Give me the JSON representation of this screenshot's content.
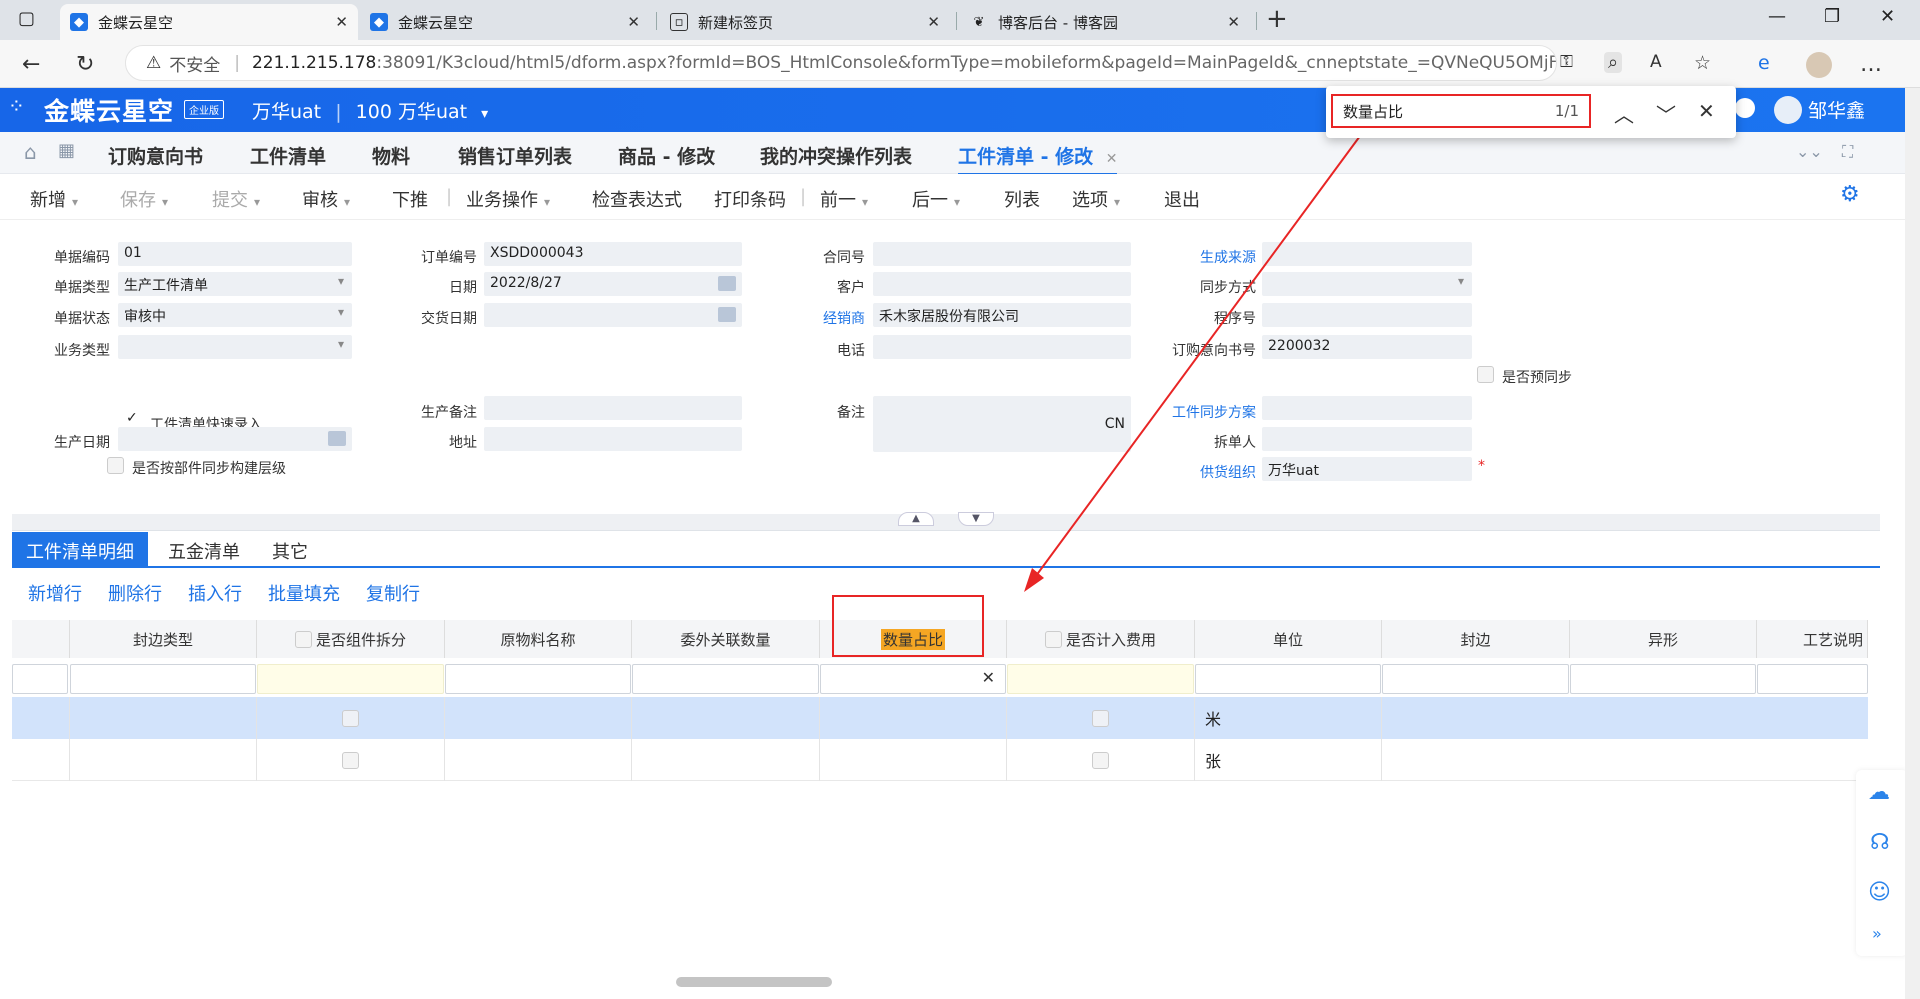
{
  "browser": {
    "tabs": [
      {
        "title": "金蝶云星空",
        "icon": "kingdee-icon"
      },
      {
        "title": "金蝶云星空",
        "icon": "kingdee-icon"
      },
      {
        "title": "新建标签页",
        "icon": "new-tab-icon"
      },
      {
        "title": "博客后台 - 博客园",
        "icon": "cnblogs-icon"
      }
    ],
    "security_label": "不安全",
    "url_host": "221.1.215.178",
    "url_rest": ":38091/K3cloud/html5/dform.aspx?formId=BOS_HtmlConsole&formType=mobileform&pageId=MainPageId&_cnneptstate_=QVNeQU5OMjFBTk5WQU..."
  },
  "find": {
    "query": "数量占比",
    "count": "1/1"
  },
  "app": {
    "brand": "金蝶云星空",
    "edition": "企业版",
    "org": "万华uat",
    "sep": "|",
    "org_code": "100 万华uat",
    "user": "邹华鑫",
    "tabs": [
      "订购意向书",
      "工件清单",
      "物料",
      "销售订单列表",
      "商品 - 修改",
      "我的冲突操作列表",
      "工件清单 - 修改"
    ]
  },
  "toolbar": [
    "新增",
    "保存",
    "提交",
    "审核",
    "下推",
    "业务操作",
    "检查表达式",
    "打印条码",
    "前一",
    "后一",
    "列表",
    "选项",
    "退出"
  ],
  "form": {
    "doc_no_label": "单据编码",
    "doc_no": "01",
    "doc_type_label": "单据类型",
    "doc_type": "生产工件清单",
    "doc_status_label": "单据状态",
    "doc_status": "审核中",
    "biz_type_label": "业务类型",
    "quick_entry_label": "工件清单快速录入",
    "prod_date_label": "生产日期",
    "sync_layer_label": "是否按部件同步构建层级",
    "order_no_label": "订单编号",
    "order_no": "XSDD000043",
    "date_label": "日期",
    "date": "2022/8/27",
    "delivery_label": "交货日期",
    "prod_note_label": "生产备注",
    "address_label": "地址",
    "contract_label": "合同号",
    "customer_label": "客户",
    "dealer_label": "经销商",
    "dealer": "禾木家居股份有限公司",
    "phone_label": "电话",
    "remark_label": "备注",
    "remark": "CN",
    "source_label": "生成来源",
    "sync_mode_label": "同步方式",
    "proc_no_label": "程序号",
    "intent_no_label": "订购意向书号",
    "intent_no": "2200032",
    "pre_sync_label": "是否预同步",
    "sync_plan_label": "工件同步方案",
    "splitter_label": "拆单人",
    "supply_org_label": "供货组织",
    "supply_org": "万华uat"
  },
  "detail": {
    "tabs": [
      "工件清单明细",
      "五金清单",
      "其它"
    ],
    "actions": [
      "新增行",
      "删除行",
      "插入行",
      "批量填充",
      "复制行"
    ],
    "columns": [
      "封边类型",
      "是否组件拆分",
      "原物料名称",
      "委外关联数量",
      "数量占比",
      "是否计入费用",
      "单位",
      "封边",
      "异形",
      "工艺说明"
    ],
    "rows": [
      {
        "unit": "米"
      },
      {
        "unit": "张"
      }
    ]
  }
}
